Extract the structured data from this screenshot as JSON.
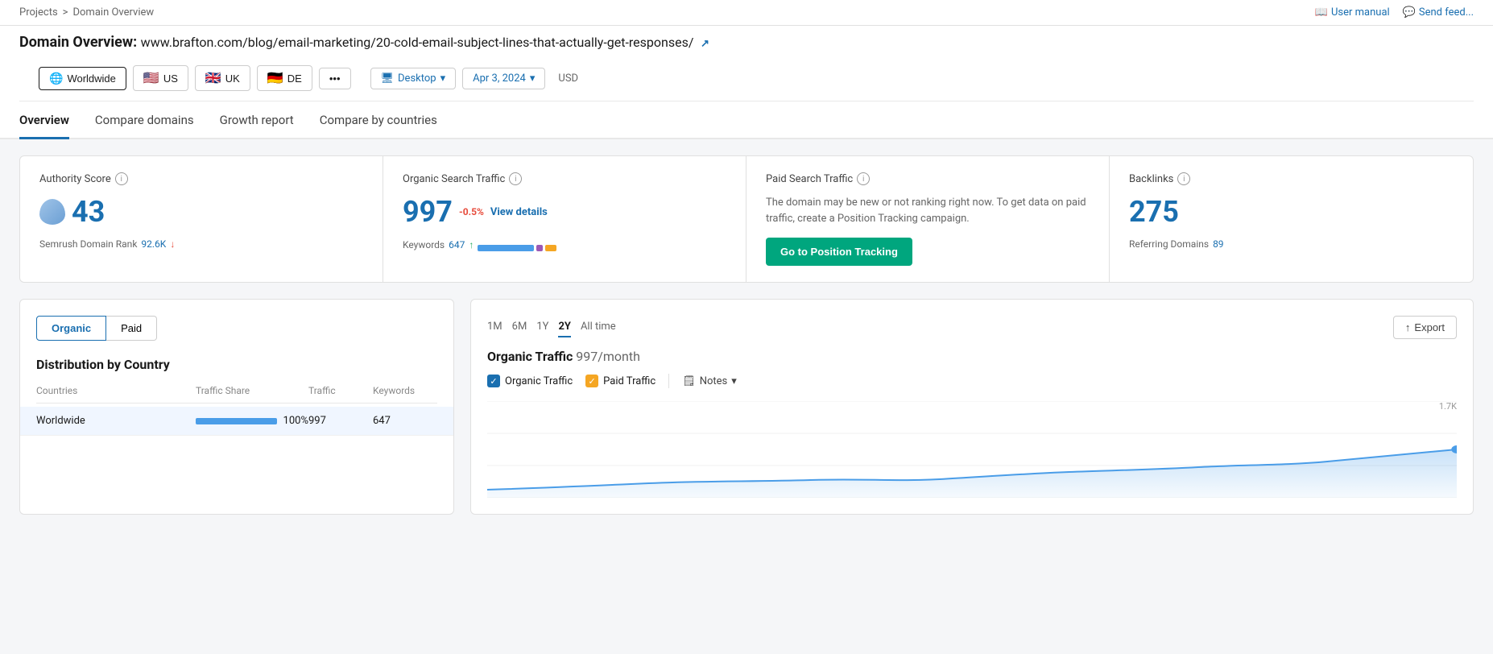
{
  "breadcrumb": {
    "projects": "Projects",
    "sep": ">",
    "current": "Domain Overview"
  },
  "topActions": {
    "userManual": "User manual",
    "sendFeedback": "Send feed..."
  },
  "domainTitle": {
    "label": "Domain Overview:",
    "url": "www.brafton.com/blog/email-marketing/20-cold-email-subject-lines-that-actually-get-responses/",
    "extLinkSymbol": "↗"
  },
  "filterBar": {
    "worldwide": "Worldwide",
    "us": "US",
    "uk": "UK",
    "de": "DE",
    "more": "•••",
    "desktop": "Desktop",
    "date": "Apr 3, 2024",
    "currency": "USD"
  },
  "tabs": [
    {
      "id": "overview",
      "label": "Overview",
      "active": true
    },
    {
      "id": "compare",
      "label": "Compare domains",
      "active": false
    },
    {
      "id": "growth",
      "label": "Growth report",
      "active": false
    },
    {
      "id": "countries",
      "label": "Compare by countries",
      "active": false
    }
  ],
  "metrics": {
    "authorityScore": {
      "title": "Authority Score",
      "value": "43",
      "footerLabel": "Semrush Domain Rank",
      "footerValue": "92.6K",
      "footerDir": "down"
    },
    "organicTraffic": {
      "title": "Organic Search Traffic",
      "value": "997",
      "change": "-0.5%",
      "viewDetails": "View details",
      "keywordsLabel": "Keywords",
      "keywordsValue": "647",
      "keywordsDir": "up"
    },
    "paidTraffic": {
      "title": "Paid Search Traffic",
      "desc": "The domain may be new or not ranking right now. To get data on paid traffic, create a Position Tracking campaign.",
      "btnLabel": "Go to Position Tracking"
    },
    "backlinks": {
      "title": "Backlinks",
      "value": "275",
      "footerLabel": "Referring Domains",
      "footerValue": "89"
    }
  },
  "leftPanel": {
    "toggleOrganic": "Organic",
    "togglePaid": "Paid",
    "sectionTitle": "Distribution by Country",
    "tableHeaders": {
      "countries": "Countries",
      "trafficShare": "Traffic Share",
      "traffic": "Traffic",
      "keywords": "Keywords"
    },
    "rows": [
      {
        "country": "Worldwide",
        "trafficShare": "100%",
        "traffic": "997",
        "keywords": "647",
        "barWidth": 120,
        "highlighted": true
      }
    ]
  },
  "rightPanel": {
    "timeBtns": [
      {
        "label": "1M",
        "active": false
      },
      {
        "label": "6M",
        "active": false
      },
      {
        "label": "1Y",
        "active": false
      },
      {
        "label": "2Y",
        "active": true
      },
      {
        "label": "All time",
        "active": false
      }
    ],
    "exportBtn": "Export",
    "chartTitle": "Organic Traffic",
    "chartValue": "997/month",
    "legend": {
      "organicTraffic": "Organic Traffic",
      "paidTraffic": "Paid Traffic",
      "notes": "Notes"
    },
    "yAxisLabel": "1.7K"
  }
}
